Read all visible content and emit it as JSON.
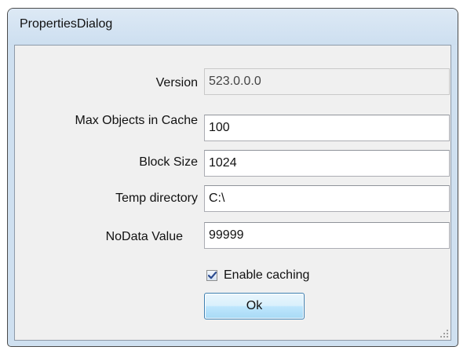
{
  "window": {
    "title": "PropertiesDialog"
  },
  "form": {
    "version_label": "Version",
    "version_value": "523.0.0.0",
    "max_objects_label": "Max Objects in Cache",
    "max_objects_value": "100",
    "block_size_label": "Block Size",
    "block_size_value": "1024",
    "temp_dir_label": "Temp directory",
    "temp_dir_value": "C:\\",
    "nodata_label": "NoData Value",
    "nodata_value": "99999",
    "enable_caching_label": "Enable caching",
    "enable_caching_checked": true,
    "ok_label": "Ok"
  },
  "colors": {
    "title_bar": "#cddff0",
    "client_background": "#f0f0f0",
    "button_border": "#3c7fb1"
  }
}
